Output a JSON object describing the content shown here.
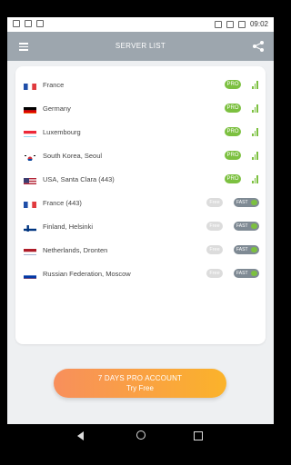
{
  "status_bar": {
    "time": "09:02"
  },
  "app_bar": {
    "title": "SERVER LIST"
  },
  "servers": [
    {
      "name": "France",
      "flag": "fr",
      "tier": "pro",
      "badge": "PRO"
    },
    {
      "name": "Germany",
      "flag": "de",
      "tier": "pro",
      "badge": "PRO"
    },
    {
      "name": "Luxembourg",
      "flag": "lu",
      "tier": "pro",
      "badge": "PRO"
    },
    {
      "name": "South Korea, Seoul",
      "flag": "kr",
      "tier": "pro",
      "badge": "PRO"
    },
    {
      "name": "USA, Santa Clara (443)",
      "flag": "us",
      "tier": "pro",
      "badge": "PRO"
    },
    {
      "name": "France (443)",
      "flag": "fr",
      "tier": "free",
      "badge": "Free",
      "speed": "FAST"
    },
    {
      "name": "Finland, Helsinki",
      "flag": "fi",
      "tier": "free",
      "badge": "Free",
      "speed": "FAST"
    },
    {
      "name": "Netherlands, Dronten",
      "flag": "nl",
      "tier": "free",
      "badge": "Free",
      "speed": "FAST"
    },
    {
      "name": "Russian Federation, Moscow",
      "flag": "ru",
      "tier": "free",
      "badge": "Free",
      "speed": "FAST"
    }
  ],
  "promo": {
    "line1": "7 DAYS PRO ACCOUNT",
    "line2": "Try Free"
  },
  "colors": {
    "app_bar": "#9da6ae",
    "pro_green": "#7cc040",
    "promo_start": "#f88f5c",
    "promo_end": "#fbb32a"
  }
}
